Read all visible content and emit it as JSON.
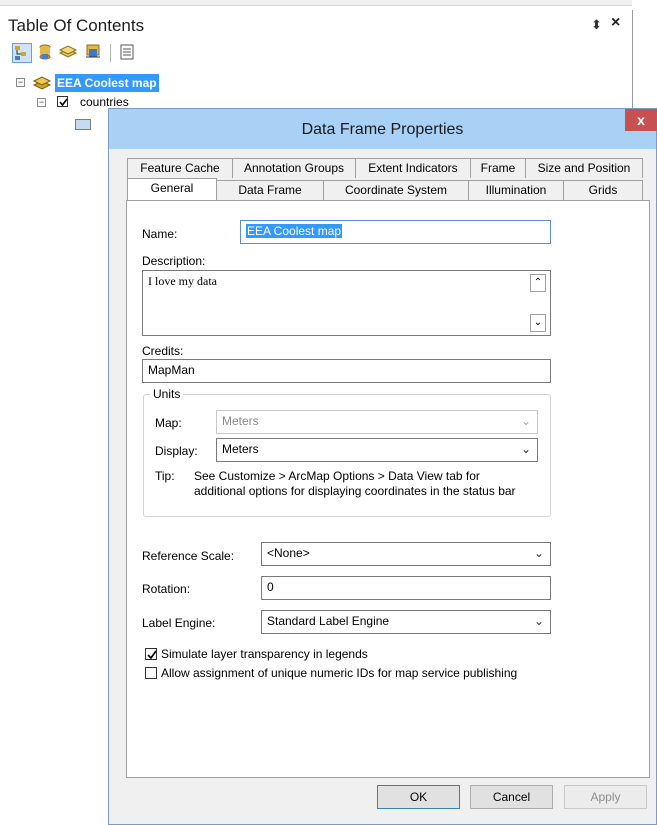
{
  "toc": {
    "title": "Table Of Contents",
    "pin_glyph": "⬍",
    "close_glyph": "×",
    "toolbar_icons": [
      "list-by-drawing-order-icon",
      "list-by-source-icon",
      "list-by-visibility-icon",
      "list-by-selection-icon",
      "options-icon"
    ],
    "data_frame_name": "EEA Coolest map",
    "layer_name": "countries"
  },
  "dialog": {
    "title": "Data Frame Properties",
    "close_glyph": "x",
    "tabs_row1": [
      "Feature Cache",
      "Annotation Groups",
      "Extent Indicators",
      "Frame",
      "Size and Position"
    ],
    "tabs_row2": [
      "General",
      "Data Frame",
      "Coordinate System",
      "Illumination",
      "Grids"
    ],
    "active_tab": "General",
    "general": {
      "name_label": "Name:",
      "name_value": "EEA Coolest map",
      "description_label": "Description:",
      "description_value": "I love my data",
      "credits_label": "Credits:",
      "credits_value": "MapMan",
      "units_legend": "Units",
      "map_label": "Map:",
      "map_value": "Meters",
      "display_label": "Display:",
      "display_value": "Meters",
      "tip_label": "Tip:",
      "tip_line1": "See Customize > ArcMap Options > Data View tab for",
      "tip_line2": "additional options for displaying coordinates in the status bar",
      "reference_scale_label": "Reference Scale:",
      "reference_scale_value": "<None>",
      "rotation_label": "Rotation:",
      "rotation_value": "0",
      "label_engine_label": "Label Engine:",
      "label_engine_value": "Standard Label Engine",
      "simulate_transparency_label": "Simulate layer transparency in legends",
      "simulate_transparency_checked": true,
      "allow_unique_ids_label": "Allow assignment of unique numeric IDs for map service publishing",
      "allow_unique_ids_checked": false
    },
    "buttons": {
      "ok": "OK",
      "cancel": "Cancel",
      "apply": "Apply"
    }
  },
  "colors": {
    "titlebar": "#a9d1f5",
    "selection": "#3399ff",
    "close_button": "#c75050"
  }
}
